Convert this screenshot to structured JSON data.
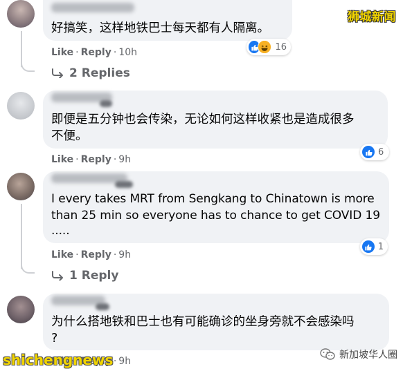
{
  "watermarks": {
    "top_right": "狮城新闻",
    "bottom_left": "shichengnews",
    "bottom_right": "新加坡华人圈"
  },
  "colors": {
    "like_blue": "#1877f2",
    "haha_yellow": "#f7b125",
    "bubble_bg": "#f0f2f5",
    "meta_gray": "#65676b",
    "watermark_yellow": "#f1d400"
  },
  "actions": {
    "like": "Like",
    "reply": "Reply",
    "dot": "·"
  },
  "comments": [
    {
      "text_lines": [
        "好搞笑，这样地铁巴士每天都有人隔离。"
      ],
      "reactions": [
        "like-icon",
        "haha-icon"
      ],
      "reaction_count": "16",
      "time": "10h",
      "replies": "2 Replies"
    },
    {
      "text_lines": [
        "即便是五分钟也会传染，无论如何这样收紧也是造成很多",
        "不便。"
      ],
      "reactions": [
        "like-icon"
      ],
      "reaction_count": "6",
      "time": "9h"
    },
    {
      "text_lines": [
        "I every takes MRT from Sengkang to Chinatown is more",
        "than 25 min so everyone has to chance to get COVID 19",
        "....."
      ],
      "reactions": [
        "like-icon"
      ],
      "reaction_count": "1",
      "time": "9h",
      "replies": "1 Reply"
    },
    {
      "text_lines": [
        "为什么搭地铁和巴士也有可能确诊的坐身旁就不会感染吗",
        "?"
      ],
      "reactions": [],
      "time": "9h"
    }
  ]
}
